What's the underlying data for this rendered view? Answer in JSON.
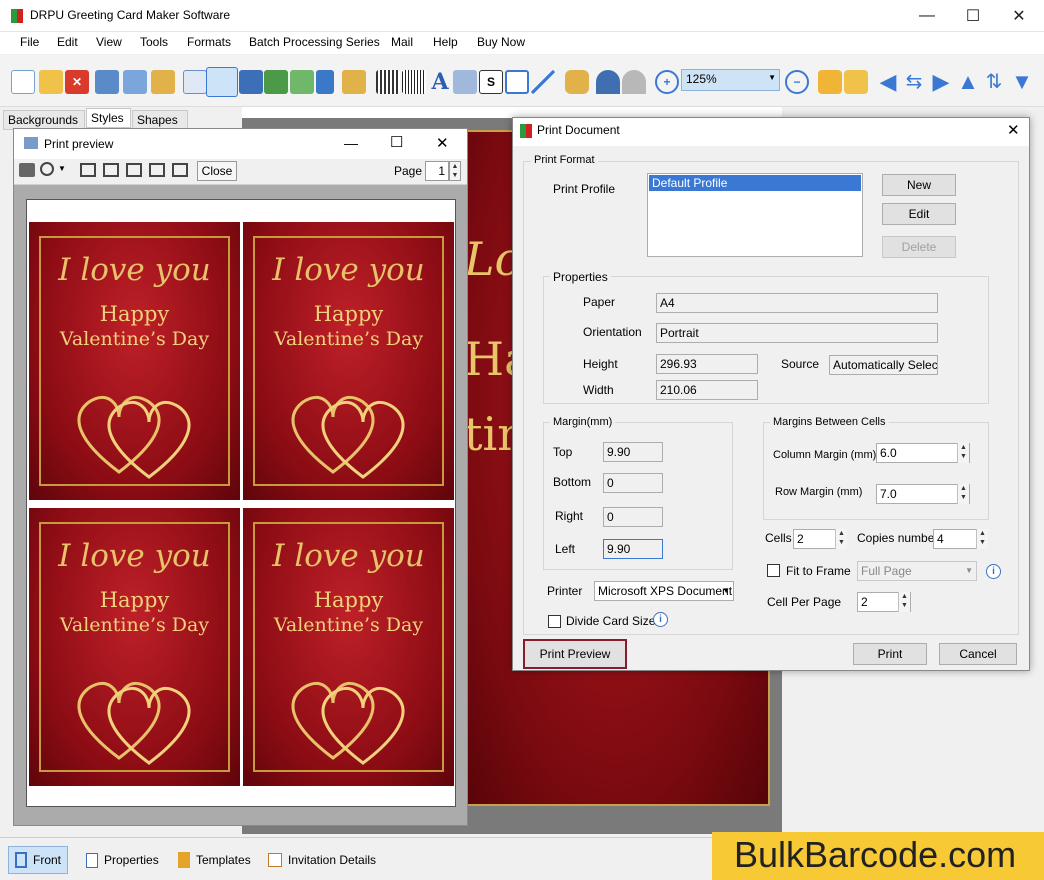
{
  "app": {
    "title": "DRPU Greeting Card Maker Software"
  },
  "window_controls": {
    "minimize": "—",
    "maximize": "☐",
    "close": "✕"
  },
  "menu": [
    "File",
    "Edit",
    "View",
    "Tools",
    "Formats",
    "Batch Processing Series",
    "Mail",
    "Help",
    "Buy Now"
  ],
  "toolbar": {
    "zoom_value": "125%"
  },
  "left_tabs": [
    "Backgrounds",
    "Styles",
    "Shapes"
  ],
  "canvas_card": {
    "line1": "Love",
    "line2": "Hap",
    "line3": "tin"
  },
  "print_preview": {
    "title": "Print preview",
    "close_label": "Close",
    "page_label": "Page",
    "page_value": "1",
    "cards": [
      {
        "line1": "I love you",
        "line2": "Happy",
        "line3": "Valentine’s Day"
      },
      {
        "line1": "I love you",
        "line2": "Happy",
        "line3": "Valentine’s Day"
      },
      {
        "line1": "I love you",
        "line2": "Happy",
        "line3": "Valentine’s Day"
      },
      {
        "line1": "I love you",
        "line2": "Happy",
        "line3": "Valentine’s Day"
      }
    ]
  },
  "print_dialog": {
    "title": "Print Document",
    "print_format_label": "Print Format",
    "print_profile_label": "Print Profile",
    "profiles": [
      "Default Profile"
    ],
    "new_label": "New",
    "edit_label": "Edit",
    "delete_label": "Delete",
    "properties_label": "Properties",
    "paper_label": "Paper",
    "paper_value": "A4",
    "orientation_label": "Orientation",
    "orientation_value": "Portrait",
    "height_label": "Height",
    "height_value": "296.93",
    "width_label": "Width",
    "width_value": "210.06",
    "source_label": "Source",
    "source_value": "Automatically Select",
    "margin_label": "Margin(mm)",
    "top_label": "Top",
    "top_value": "9.90",
    "bottom_label": "Bottom",
    "bottom_value": "0",
    "right_label": "Right",
    "right_value": "0",
    "left_label": "Left",
    "left_value": "9.90",
    "margins_between_label": "Margins Between Cells",
    "column_margin_label": "Column Margin (mm)",
    "column_margin_value": "6.0",
    "row_margin_label": "Row Margin (mm)",
    "row_margin_value": "7.0",
    "cells_label": "Cells",
    "cells_value": "2",
    "copies_label": "Copies number",
    "copies_value": "4",
    "fit_to_frame_label": "Fit to Frame",
    "fit_select_value": "Full Page",
    "cell_per_page_label": "Cell Per Page",
    "cell_per_page_value": "2",
    "printer_label": "Printer",
    "printer_value": "Microsoft XPS Document",
    "divide_card_label": "Divide Card Size",
    "print_preview_label": "Print Preview",
    "print_label": "Print",
    "cancel_label": "Cancel"
  },
  "status_tabs": [
    "Front",
    "Properties",
    "Templates",
    "Invitation Details"
  ],
  "brand": {
    "text": "BulkBarcode.com"
  },
  "colors": {
    "accent_blue": "#3a78d4",
    "card_red": "#8c0c14",
    "gold": "#e8c26a",
    "brand_yellow": "#f7c934",
    "preview_btn_border": "#8b1a2a"
  }
}
